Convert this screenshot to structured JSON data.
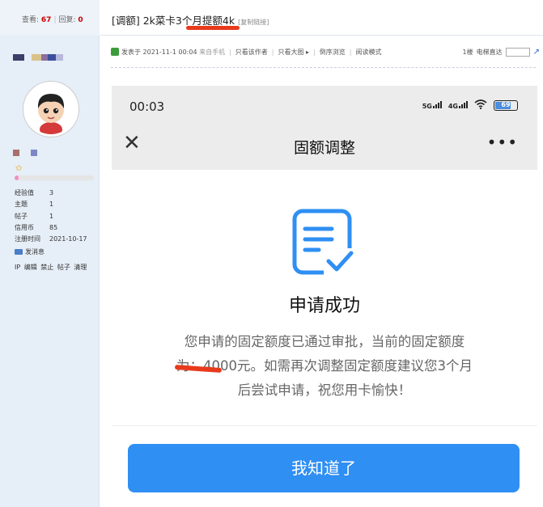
{
  "forum": {
    "stats": {
      "views_label": "查看:",
      "views": "67",
      "replies_label": "回复:",
      "replies": "0"
    },
    "thread": {
      "title": "[调额] 2k菜卡3个月提额4k",
      "copy_link": "[复制链接]"
    },
    "user": {
      "info": [
        {
          "k": "经验值",
          "v": "3"
        },
        {
          "k": "主题",
          "v": "1"
        },
        {
          "k": "帖子",
          "v": "1"
        },
        {
          "k": "信用币",
          "v": "85"
        },
        {
          "k": "注册时间",
          "v": "2021-10-17"
        }
      ],
      "send_message": "发消息",
      "admin_links": [
        "IP",
        "编辑",
        "禁止",
        "帖子",
        "清理"
      ],
      "level_progress": 0.05
    },
    "post_meta": {
      "posted": "发表于 2021-11-1 00:04",
      "source": "来自手机",
      "only_author": "只看该作者",
      "big_image": "只看大图",
      "reverse": "倒序浏览",
      "read_mode": "阅读模式",
      "floor": "1楼",
      "jump_label": "电梯直达"
    },
    "colors": {
      "accent": "#2f8ff3",
      "highlight": "#e83a1c",
      "sidebar": "#e6eef7"
    }
  },
  "phone": {
    "status": {
      "time": "00:03",
      "net1": "5G",
      "net2": "4G",
      "battery": "69"
    },
    "nav": {
      "title": "固额调整",
      "close_icon": "close-icon",
      "more_icon": "more-icon"
    },
    "result": {
      "heading": "申请成功",
      "line1": "您申请的固定额度已通过审批，当前的固定额度",
      "line2": "为：4000元。如需再次调整固定额度建议您3个月",
      "line3": "后尝试申请，祝您用卡愉快！"
    },
    "button": "我知道了"
  }
}
